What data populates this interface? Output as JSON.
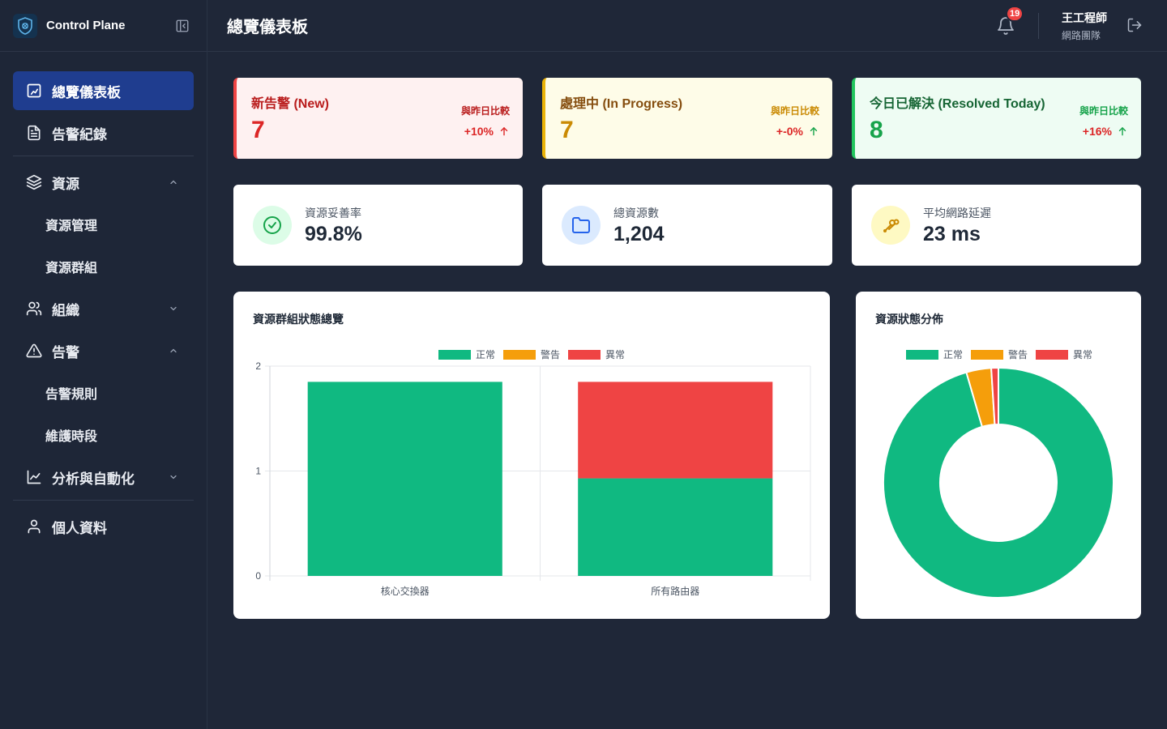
{
  "app": {
    "title": "Control Plane"
  },
  "header": {
    "page_title": "總覽儀表板",
    "notification_count": "19",
    "user_name": "王工程師",
    "user_team": "網路團隊"
  },
  "sidebar": {
    "items": [
      {
        "label": "總覽儀表板"
      },
      {
        "label": "告警紀錄"
      },
      {
        "label": "資源"
      },
      {
        "label": "資源管理"
      },
      {
        "label": "資源群組"
      },
      {
        "label": "組織"
      },
      {
        "label": "告警"
      },
      {
        "label": "告警規則"
      },
      {
        "label": "維護時段"
      },
      {
        "label": "分析與自動化"
      },
      {
        "label": "個人資料"
      }
    ]
  },
  "stats": [
    {
      "label": "新告警 (New)",
      "value": "7",
      "compare_label": "與昨日比較",
      "compare_value": "+10%",
      "color": "#dc2626"
    },
    {
      "label": "處理中 (In Progress)",
      "value": "7",
      "compare_label": "與昨日比較",
      "compare_value": "+-0%",
      "color": "#ca8a04"
    },
    {
      "label": "今日已解決 (Resolved Today)",
      "value": "8",
      "compare_label": "與昨日比較",
      "compare_value": "+16%",
      "color": "#16a34a"
    }
  ],
  "metrics": [
    {
      "label": "資源妥善率",
      "value": "99.8%"
    },
    {
      "label": "總資源數",
      "value": "1,204"
    },
    {
      "label": "平均網路延遲",
      "value": "23 ms"
    }
  ],
  "colors": {
    "normal": "#10b981",
    "warning": "#f59e0b",
    "abnormal": "#ef4444"
  },
  "chart_data": [
    {
      "type": "bar",
      "stacked": true,
      "title": "資源群組狀態總覽",
      "categories": [
        "核心交換器",
        "所有路由器"
      ],
      "series": [
        {
          "name": "正常",
          "values": [
            1.85,
            0.93
          ]
        },
        {
          "name": "警告",
          "values": [
            0,
            0
          ]
        },
        {
          "name": "異常",
          "values": [
            0,
            0.92
          ]
        }
      ],
      "ylim": [
        0,
        2
      ],
      "yticks": [
        "0",
        "1",
        "2"
      ],
      "legend": "top-center",
      "grid": true
    },
    {
      "type": "pie",
      "donut": true,
      "title": "資源狀態分佈",
      "labels": [
        "正常",
        "警告",
        "異常"
      ],
      "values": [
        95.5,
        3.5,
        1.0
      ],
      "legend": "top-center"
    }
  ]
}
